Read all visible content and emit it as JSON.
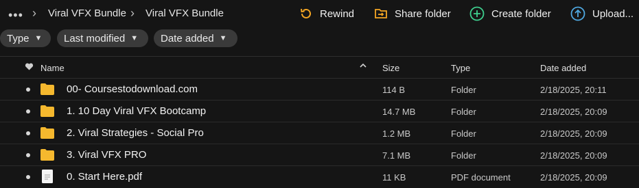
{
  "breadcrumb": {
    "more_label": "•••",
    "items": [
      "Viral VFX Bundle",
      "Viral VFX Bundle"
    ]
  },
  "actions": {
    "rewind": "Rewind",
    "share_folder": "Share folder",
    "create_folder": "Create folder",
    "upload": "Upload..."
  },
  "filters": {
    "type": "Type",
    "last_modified": "Last modified",
    "date_added": "Date added"
  },
  "table": {
    "columns": {
      "name": "Name",
      "size": "Size",
      "type": "Type",
      "date_added": "Date added"
    },
    "rows": [
      {
        "name": "00- Coursestodownload.com",
        "size": "114 B",
        "type": "Folder",
        "date": "2/18/2025, 20:11",
        "icon": "folder-icon"
      },
      {
        "name": "1. 10 Day Viral VFX Bootcamp",
        "size": "14.7 MB",
        "type": "Folder",
        "date": "2/18/2025, 20:09",
        "icon": "folder-icon"
      },
      {
        "name": "2. Viral Strategies - Social Pro",
        "size": "1.2 MB",
        "type": "Folder",
        "date": "2/18/2025, 20:09",
        "icon": "folder-icon"
      },
      {
        "name": "3. Viral VFX PRO",
        "size": "7.1 MB",
        "type": "Folder",
        "date": "2/18/2025, 20:09",
        "icon": "folder-icon"
      },
      {
        "name": "0. Start Here.pdf",
        "size": "11 KB",
        "type": "PDF document",
        "date": "2/18/2025, 20:09",
        "icon": "document-icon"
      }
    ]
  },
  "colors": {
    "background": "#151515",
    "folder": "#f5b82e",
    "rewind": "#f5a623",
    "create_folder": "#3ecf8e",
    "upload": "#4fa8e0"
  }
}
